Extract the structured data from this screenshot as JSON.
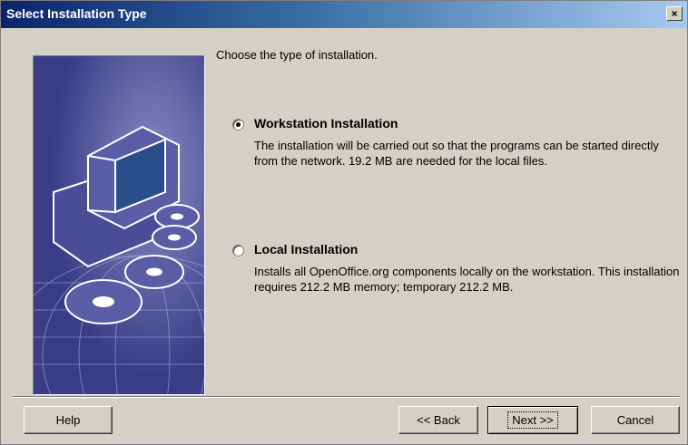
{
  "window": {
    "title": "Select Installation Type",
    "close_label": "×"
  },
  "heading": "Choose the type of installation.",
  "options": [
    {
      "label": "Workstation Installation",
      "description": "The installation will be carried out so that the programs can be started directly from the network. 19.2 MB are needed for the local files.",
      "selected": true
    },
    {
      "label": "Local Installation",
      "description": "Installs all OpenOffice.org components locally on the workstation. This installation requires 212.2 MB memory; temporary 212.2 MB.",
      "selected": false
    }
  ],
  "buttons": {
    "help": "Help",
    "back": "<< Back",
    "next": "Next >>",
    "cancel": "Cancel"
  },
  "colors": {
    "dialog_bg": "#d4d0c8",
    "title_start": "#0a246a",
    "title_end": "#a6caf0",
    "art_bg": "#3a3c86"
  }
}
